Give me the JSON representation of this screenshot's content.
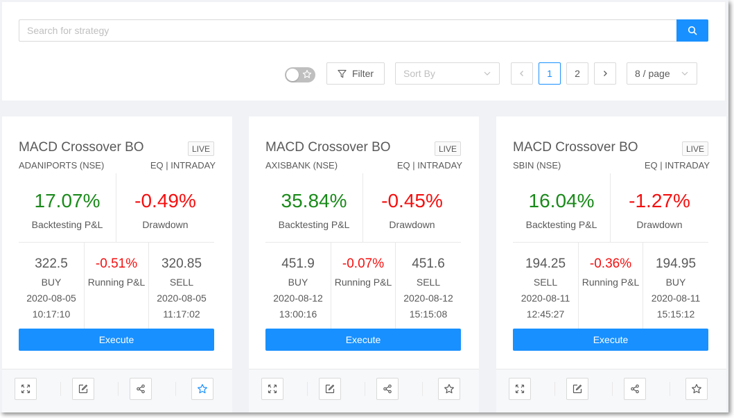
{
  "search": {
    "placeholder": "Search for strategy"
  },
  "toolbar": {
    "filter_label": "Filter",
    "sort_placeholder": "Sort By",
    "pages": [
      "1",
      "2"
    ],
    "current_page": "1",
    "page_size": "8 / page"
  },
  "colors": {
    "accent": "#1890ff",
    "positive": "#1a8a1a",
    "negative": "#f50f0f"
  },
  "cards": [
    {
      "title": "MACD Crossover BO",
      "tag": "LIVE",
      "symbol": "ADANIPORTS (NSE)",
      "segment": "EQ | INTRADAY",
      "backtest_pnl": "17.07%",
      "backtest_label": "Backtesting P&L",
      "drawdown": "-0.49%",
      "drawdown_label": "Drawdown",
      "entry_price": "322.5",
      "entry_side": "BUY",
      "entry_date": "2020-08-05",
      "entry_time": "10:17:10",
      "running_pnl": "-0.51%",
      "running_label": "Running P&L",
      "exit_price": "320.85",
      "exit_side": "SELL",
      "exit_date": "2020-08-05",
      "exit_time": "11:17:02",
      "execute_label": "Execute",
      "favorited": true
    },
    {
      "title": "MACD Crossover BO",
      "tag": "LIVE",
      "symbol": "AXISBANK (NSE)",
      "segment": "EQ | INTRADAY",
      "backtest_pnl": "35.84%",
      "backtest_label": "Backtesting P&L",
      "drawdown": "-0.45%",
      "drawdown_label": "Drawdown",
      "entry_price": "451.9",
      "entry_side": "BUY",
      "entry_date": "2020-08-12",
      "entry_time": "13:00:16",
      "running_pnl": "-0.07%",
      "running_label": "Running P&L",
      "exit_price": "451.6",
      "exit_side": "SELL",
      "exit_date": "2020-08-12",
      "exit_time": "15:15:08",
      "execute_label": "Execute",
      "favorited": false
    },
    {
      "title": "MACD Crossover BO",
      "tag": "LIVE",
      "symbol": "SBIN (NSE)",
      "segment": "EQ | INTRADAY",
      "backtest_pnl": "16.04%",
      "backtest_label": "Backtesting P&L",
      "drawdown": "-1.27%",
      "drawdown_label": "Drawdown",
      "entry_price": "194.25",
      "entry_side": "SELL",
      "entry_date": "2020-08-11",
      "entry_time": "12:45:27",
      "running_pnl": "-0.36%",
      "running_label": "Running P&L",
      "exit_price": "194.95",
      "exit_side": "BUY",
      "exit_date": "2020-08-11",
      "exit_time": "15:15:12",
      "execute_label": "Execute",
      "favorited": false
    }
  ],
  "card_actions": [
    "expand-icon",
    "edit-icon",
    "share-icon",
    "star-icon"
  ]
}
